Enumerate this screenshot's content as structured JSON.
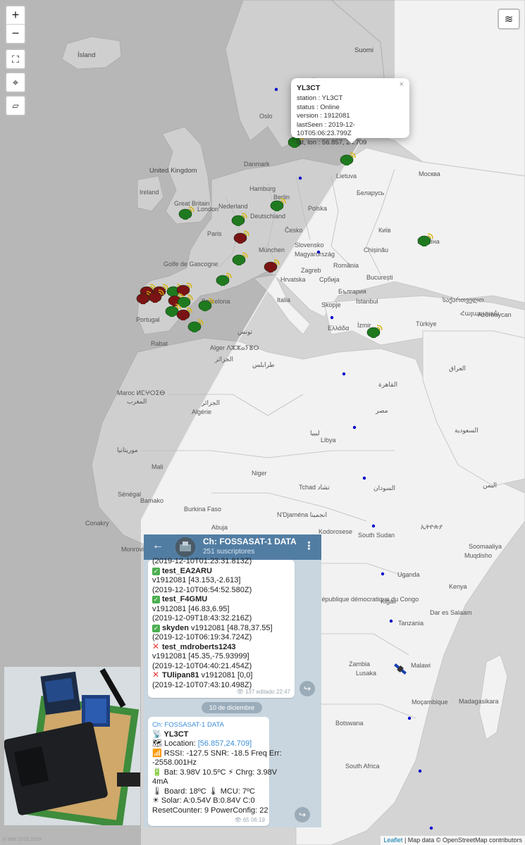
{
  "map": {
    "labels": [
      {
        "text": "Ísland",
        "cls": "lbl-big"
      },
      {
        "text": "Suomi",
        "cls": "lbl-big"
      },
      {
        "text": "Oslo",
        "cls": ""
      },
      {
        "text": "Danmark",
        "cls": ""
      },
      {
        "text": "United Kingdom",
        "cls": "lbl-big"
      },
      {
        "text": "Ireland",
        "cls": ""
      },
      {
        "text": "Great Britain",
        "cls": ""
      },
      {
        "text": "London",
        "cls": ""
      },
      {
        "text": "Hamburg",
        "cls": ""
      },
      {
        "text": "Berlin",
        "cls": ""
      },
      {
        "text": "Nederland",
        "cls": ""
      },
      {
        "text": "Deutschland",
        "cls": ""
      },
      {
        "text": "Polska",
        "cls": ""
      },
      {
        "text": "Lietuva",
        "cls": ""
      },
      {
        "text": "Москва",
        "cls": ""
      },
      {
        "text": "Беларусь",
        "cls": ""
      },
      {
        "text": "Paris",
        "cls": ""
      },
      {
        "text": "Česko",
        "cls": ""
      },
      {
        "text": "München",
        "cls": ""
      },
      {
        "text": "Slovensko",
        "cls": ""
      },
      {
        "text": "Київ",
        "cls": ""
      },
      {
        "text": "Україна",
        "cls": ""
      },
      {
        "text": "Magyarország",
        "cls": ""
      },
      {
        "text": "Chișinău",
        "cls": ""
      },
      {
        "text": "Golfe de Gascogne",
        "cls": ""
      },
      {
        "text": "Zagreb",
        "cls": ""
      },
      {
        "text": "România",
        "cls": ""
      },
      {
        "text": "Hrvatska",
        "cls": ""
      },
      {
        "text": "Србија",
        "cls": ""
      },
      {
        "text": "București",
        "cls": ""
      },
      {
        "text": "България",
        "cls": ""
      },
      {
        "text": "Portugal",
        "cls": ""
      },
      {
        "text": "Barcelona",
        "cls": ""
      },
      {
        "text": "Italia",
        "cls": ""
      },
      {
        "text": "Skopje",
        "cls": ""
      },
      {
        "text": "İstanbul",
        "cls": ""
      },
      {
        "text": "საქართველო",
        "cls": ""
      },
      {
        "text": "Հայաստան",
        "cls": ""
      },
      {
        "text": "Azərbaycan",
        "cls": ""
      },
      {
        "text": "Ελλάδα",
        "cls": ""
      },
      {
        "text": "İzmir",
        "cls": ""
      },
      {
        "text": "Türkiye",
        "cls": ""
      },
      {
        "text": "تونس",
        "cls": ""
      },
      {
        "text": "Rabat",
        "cls": ""
      },
      {
        "text": "Alger ⴷⵣⵣⴰⵢⴻⵔ",
        "cls": ""
      },
      {
        "text": "الجزائر",
        "cls": ""
      },
      {
        "text": "طرابلس",
        "cls": ""
      },
      {
        "text": "Maroc ⵍⵎⵖⵔⵉⴱ",
        "cls": ""
      },
      {
        "text": "المغرب",
        "cls": ""
      },
      {
        "text": "الجزائر",
        "cls": ""
      },
      {
        "text": "Algérie",
        "cls": ""
      },
      {
        "text": "ليبيا",
        "cls": ""
      },
      {
        "text": "Libya",
        "cls": ""
      },
      {
        "text": "القاهرة",
        "cls": ""
      },
      {
        "text": "مصر",
        "cls": ""
      },
      {
        "text": "العراق",
        "cls": ""
      },
      {
        "text": "السعودية",
        "cls": ""
      },
      {
        "text": "اليمن",
        "cls": ""
      },
      {
        "text": "موريتانيا",
        "cls": ""
      },
      {
        "text": "Mali",
        "cls": ""
      },
      {
        "text": "Niger",
        "cls": ""
      },
      {
        "text": "Tchad تشاد",
        "cls": ""
      },
      {
        "text": "السودان",
        "cls": ""
      },
      {
        "text": "Sénégal",
        "cls": ""
      },
      {
        "text": "Bamako",
        "cls": ""
      },
      {
        "text": "Burkina Faso",
        "cls": ""
      },
      {
        "text": "Abuja",
        "cls": ""
      },
      {
        "text": "Nigeria",
        "cls": ""
      },
      {
        "text": "N'Djaména انجمينا",
        "cls": ""
      },
      {
        "text": "Conakry",
        "cls": ""
      },
      {
        "text": "Monrovia",
        "cls": ""
      },
      {
        "text": "South Sudan",
        "cls": ""
      },
      {
        "text": "ኢትዮጵያ",
        "cls": ""
      },
      {
        "text": "Soomaaliya",
        "cls": ""
      },
      {
        "text": "Muqdisho",
        "cls": ""
      },
      {
        "text": "Kodorosese",
        "cls": ""
      },
      {
        "text": "Uganda",
        "cls": ""
      },
      {
        "text": "Kenya",
        "cls": ""
      },
      {
        "text": "Kigali",
        "cls": ""
      },
      {
        "text": "République démocratique du Congo",
        "cls": ""
      },
      {
        "text": "Tanzania",
        "cls": ""
      },
      {
        "text": "Dar es Salaam",
        "cls": ""
      },
      {
        "text": "Zambia",
        "cls": ""
      },
      {
        "text": "Lusaka",
        "cls": ""
      },
      {
        "text": "Malawi",
        "cls": ""
      },
      {
        "text": "Moçambique",
        "cls": ""
      },
      {
        "text": "Madagasikara",
        "cls": ""
      },
      {
        "text": "Botswana",
        "cls": ""
      },
      {
        "text": "South Africa",
        "cls": ""
      }
    ]
  },
  "controls": {
    "zoom_in": "+",
    "zoom_out": "−",
    "fullscreen_icon": "fullscreen-icon",
    "locate_icon": "crosshair-icon",
    "measure_icon": "ruler-icon",
    "layers_icon": "layers-icon"
  },
  "popup": {
    "title": "YL3CT",
    "close": "×",
    "station": "station : YL3CT",
    "status": "status : Online",
    "version": "version : 1912081",
    "lastSeen": "lastSeen : 2019-12-10T05:06:23.799Z",
    "latlon": "lat, lon : 56.857, 24.709"
  },
  "attribution": {
    "leaflet": "Leaflet",
    "sep": " | ",
    "text": "Map data © OpenStreetMap contributors"
  },
  "ibm": "© IBM 2015,2019",
  "telegram": {
    "back": "←",
    "title": "Ch: FOSSASAT-1 DATA",
    "subscribers": "251 suscriptores",
    "menu": "⋮",
    "msg1": {
      "lines": [
        {
          "t": "(2019-12-10T01:23:31.813Z)"
        },
        {
          "t": "test_EA2ARU",
          "icon": "check",
          "bold": true
        },
        {
          "t": "v1912081 [43.153,-2.613]"
        },
        {
          "t": "(2019-12-10T06:54:52.580Z)"
        },
        {
          "t": "test_F4GMU",
          "icon": "check",
          "bold": true
        },
        {
          "t": "v1912081 [46.83,6.95]"
        },
        {
          "t": "(2019-12-09T18:43:32.216Z)"
        },
        {
          "t": "skyden",
          "rest": " v1912081 [48.78,37.55]",
          "icon": "check",
          "bold": true
        },
        {
          "t": "(2019-12-10T06:19:34.724Z)"
        },
        {
          "t": "test_mdroberts1243",
          "icon": "cross",
          "bold": true
        },
        {
          "t": "v1912081 [45.35,-75.93999]"
        },
        {
          "t": "(2019-12-10T04:40:21.454Z)"
        },
        {
          "t": "TUlipan81",
          "rest": " v1912081 [0,0]",
          "icon": "cross",
          "bold": true
        },
        {
          "t": "(2019-12-10T07:43:10.498Z)"
        }
      ],
      "meta": "👁 137  editado 22:47"
    },
    "date_pill": "10 de diciembre",
    "msg2": {
      "channel": "Ch: FOSSASAT-1 DATA",
      "station": "📡 YL3CT",
      "location_label": "🗺 Location: ",
      "location_value": "[56.857,24.709]",
      "rssi": "📶 RSSI: -127.5 SNR: -18.5 Freq Err:",
      "freq": "-2558.001Hz",
      "bat": "🔋 Bat: 3.98V 10.5ºC ⚡ Chrg: 3.98V",
      "bat2": "4mA",
      "board": "🌡 Board: 18ºC 🌡 MCU: 7ºC",
      "solar": "☀ Solar: A:0.54V B:0.84V C:0",
      "reset": "ResetCounter: 9 PowerConfig: 22",
      "meta": "👁 65  06:19"
    },
    "forward": "↪"
  }
}
